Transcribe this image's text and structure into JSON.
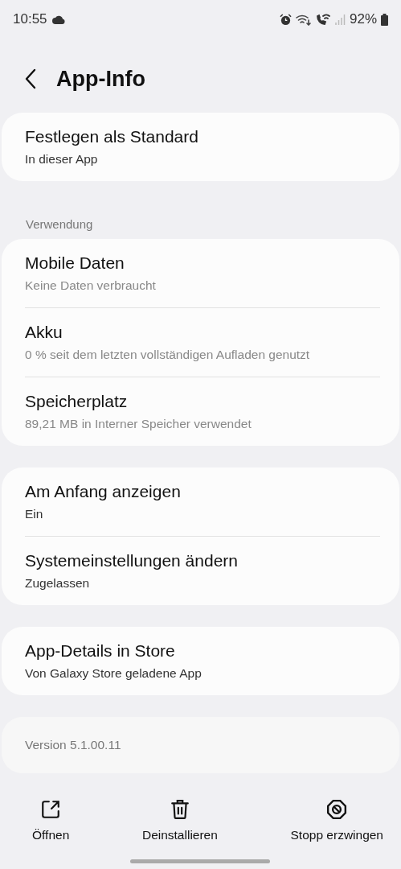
{
  "status_bar": {
    "time": "10:55",
    "battery": "92%"
  },
  "header": {
    "title": "App-Info"
  },
  "sections": [
    {
      "items": [
        {
          "title": "Festlegen als Standard",
          "subtitle": "In dieser App",
          "muted": false
        }
      ]
    },
    {
      "label": "Verwendung",
      "items": [
        {
          "title": "Mobile Daten",
          "subtitle": "Keine Daten verbraucht",
          "muted": true
        },
        {
          "title": "Akku",
          "subtitle": "0 % seit dem letzten vollständigen Aufladen genutzt",
          "muted": true
        },
        {
          "title": "Speicherplatz",
          "subtitle": "89,21 MB in Interner Speicher verwendet",
          "muted": true
        }
      ]
    },
    {
      "items": [
        {
          "title": "Am Anfang anzeigen",
          "subtitle": "Ein",
          "muted": false
        },
        {
          "title": "Systemeinstellungen ändern",
          "subtitle": "Zugelassen",
          "muted": false
        }
      ]
    },
    {
      "items": [
        {
          "title": "App-Details in Store",
          "subtitle": "Von Galaxy Store geladene App",
          "muted": false
        }
      ]
    }
  ],
  "version": "Version 5.1.00.11",
  "actions": [
    {
      "kind": "open",
      "label": "Öffnen"
    },
    {
      "kind": "uninstall",
      "label": "Deinstallieren"
    },
    {
      "kind": "stop",
      "label": "Stopp erzwingen"
    }
  ]
}
